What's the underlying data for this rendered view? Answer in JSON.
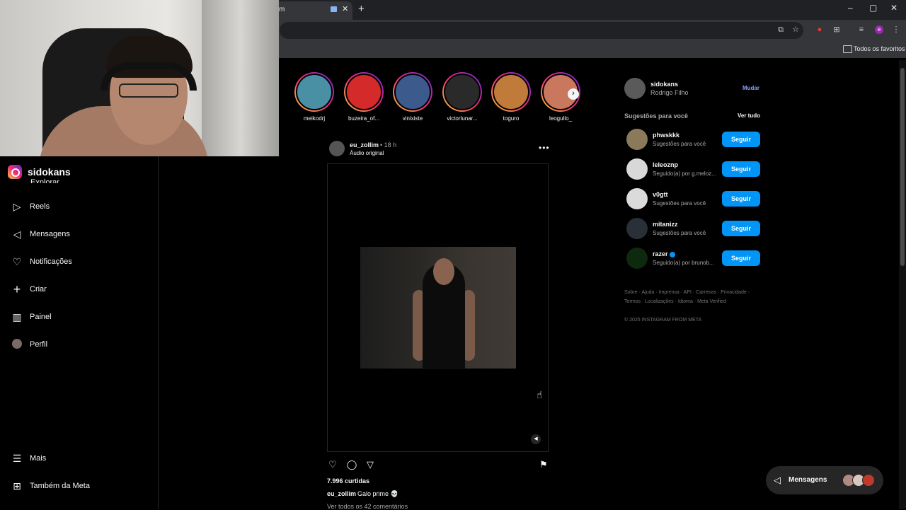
{
  "browser": {
    "tab_title": "m",
    "new_tab": "+",
    "bookmarks_folder": "Todos os favoritos",
    "window_controls": [
      "–",
      "▢",
      "✕"
    ],
    "profile_initial": "e"
  },
  "sidebar": {
    "brand": "sidokans",
    "partial_item": "Explorar",
    "items": [
      {
        "label": "Reels",
        "icon": "reels-icon"
      },
      {
        "label": "Mensagens",
        "icon": "messages-icon"
      },
      {
        "label": "Notificações",
        "icon": "heart-icon"
      },
      {
        "label": "Criar",
        "icon": "plus-icon"
      },
      {
        "label": "Painel",
        "icon": "dashboard-icon"
      },
      {
        "label": "Perfil",
        "icon": "avatar-icon"
      }
    ],
    "more": "Mais",
    "meta": "Também da Meta"
  },
  "stories": [
    {
      "name": "meikodrj",
      "color": "#4a90a4"
    },
    {
      "name": "buzeira_of...",
      "color": "#d42a2a"
    },
    {
      "name": "vinixiste",
      "color": "#3c5a8c"
    },
    {
      "name": "victorlunar...",
      "color": "#2a2a2a"
    },
    {
      "name": "toguro",
      "color": "#c07a3a"
    },
    {
      "name": "leogullo_",
      "color": "#c9785e"
    }
  ],
  "post": {
    "username": "eu_zollim",
    "time": "• 18 h",
    "audio": "Áudio original",
    "more": "•••",
    "likes": "7.996 curtidas",
    "caption_user": "eu_zollim",
    "caption_text": "Galo prime 💀",
    "comments": "Ver todos os 42 comentários"
  },
  "profile": {
    "username": "sidokans",
    "name": "Rodrigo Filho",
    "switch": "Mudar"
  },
  "suggestions": {
    "title": "Sugestões para você",
    "see_all": "Ver tudo",
    "follow_label": "Seguir",
    "items": [
      {
        "username": "phwskkk",
        "sub": "Sugestões para você",
        "color": "#8a7a5a"
      },
      {
        "username": "leleoznp",
        "sub": "Seguido(a) por g.meloz...",
        "color": "#d8d8d8"
      },
      {
        "username": "v0gtt",
        "sub": "Sugestões para você",
        "color": "#dbdbdb"
      },
      {
        "username": "mitanizz",
        "sub": "Sugestões para você",
        "color": "#2a3038"
      },
      {
        "username": "razer",
        "sub": "Seguido(a) por brunob...",
        "color": "#0e2a0e",
        "verified": true
      }
    ]
  },
  "footer": {
    "line1": "Sobre · Ajuda · Imprensa · API · Carreiras · Privacidade ·",
    "line2": "Termos · Localizações · Idioma · Meta Verified",
    "copyright": "© 2025 INSTAGRAM FROM META"
  },
  "messages_pill": {
    "label": "Mensagens"
  }
}
